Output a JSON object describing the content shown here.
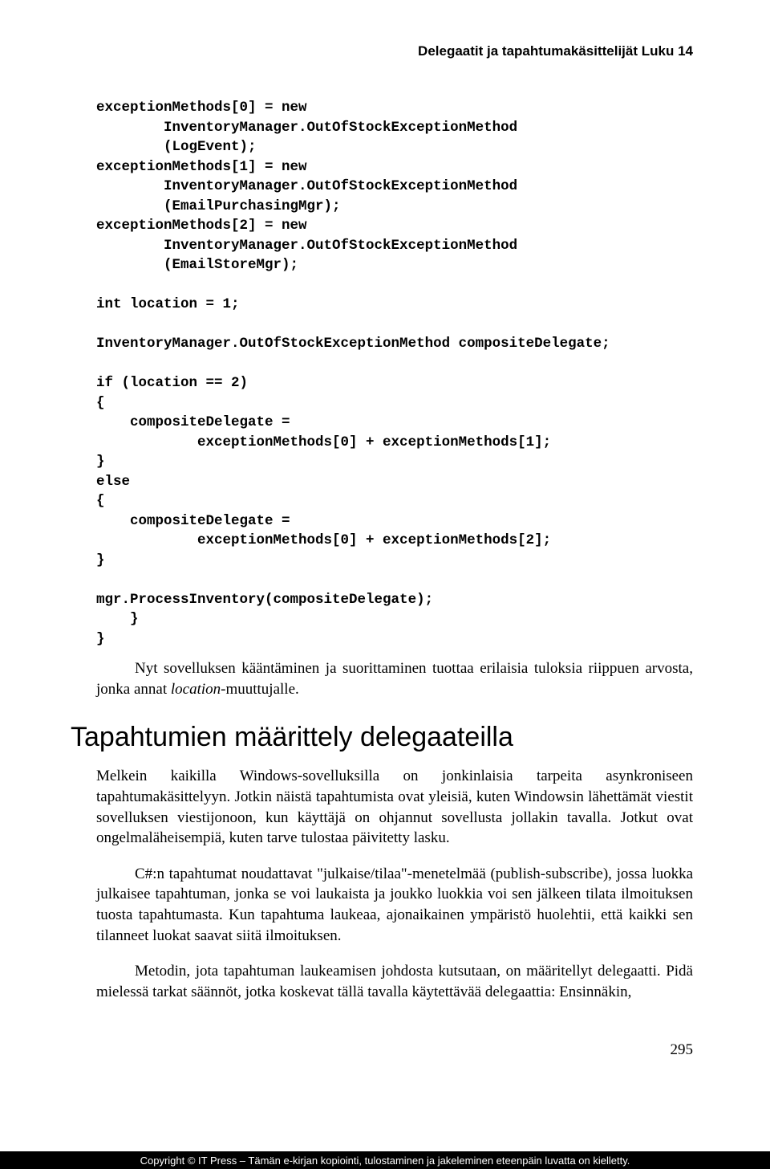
{
  "running_header": "Delegaatit ja tapahtumakäsittelijät   Luku 14",
  "code_block": "exceptionMethods[0] = new\n        InventoryManager.OutOfStockExceptionMethod\n        (LogEvent);\nexceptionMethods[1] = new\n        InventoryManager.OutOfStockExceptionMethod\n        (EmailPurchasingMgr);\nexceptionMethods[2] = new\n        InventoryManager.OutOfStockExceptionMethod\n        (EmailStoreMgr);\n\nint location = 1;\n\nInventoryManager.OutOfStockExceptionMethod compositeDelegate;\n\nif (location == 2)\n{\n    compositeDelegate =\n            exceptionMethods[0] + exceptionMethods[1];\n}\nelse\n{\n    compositeDelegate =\n            exceptionMethods[0] + exceptionMethods[2];\n}\n\nmgr.ProcessInventory(compositeDelegate);\n    }\n}",
  "after_code_para_pre": "Nyt sovelluksen kääntäminen ja suorittaminen tuottaa erilaisia tuloksia riippuen arvosta, jonka annat ",
  "after_code_para_italic": "location",
  "after_code_para_post": "-muuttujalle.",
  "section_heading": "Tapahtumien määrittely delegaateilla",
  "para1": "Melkein kaikilla Windows-sovelluksilla on jonkinlaisia tarpeita asynkroniseen tapahtumakäsittelyyn. Jotkin näistä tapahtumista ovat yleisiä, kuten Windowsin lähettämät viestit sovelluksen viestijonoon, kun käyttäjä on ohjannut sovellusta jollakin tavalla. Jotkut ovat ongelmaläheisempiä, kuten tarve tulostaa päivitetty lasku.",
  "para2": "C#:n tapahtumat noudattavat \"julkaise/tilaa\"-menetelmää (publish-subscribe), jossa luokka julkaisee tapahtuman, jonka se voi laukaista ja joukko luokkia voi sen jälkeen tilata ilmoituksen tuosta tapahtumasta. Kun tapahtuma laukeaa, ajonaikainen ympäristö huolehtii, että kaikki sen tilanneet luokat saavat siitä ilmoituksen.",
  "para3": "Metodin, jota tapahtuman laukeamisen johdosta kutsutaan, on määritellyt delegaatti. Pidä mielessä tarkat säännöt, jotka koskevat tällä tavalla käytettävää delegaattia: Ensinnäkin,",
  "page_number": "295",
  "footer_text": "Copyright © IT Press – Tämän e-kirjan kopiointi, tulostaminen ja jakeleminen eteenpäin luvatta on kielletty."
}
